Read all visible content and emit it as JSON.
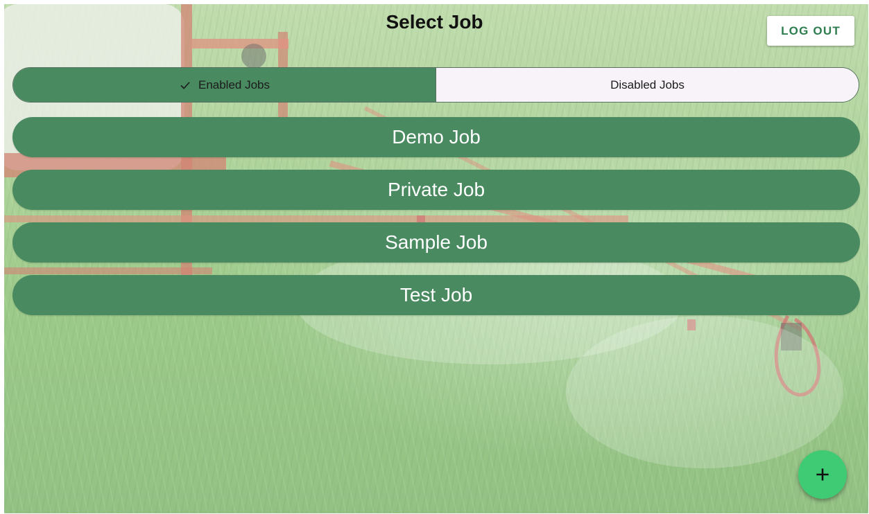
{
  "header": {
    "title": "Select Job",
    "logout_label": "LOG OUT"
  },
  "tabs": {
    "enabled_label": "Enabled Jobs",
    "disabled_label": "Disabled Jobs",
    "selected": "enabled"
  },
  "jobs": [
    {
      "label": "Demo Job"
    },
    {
      "label": "Private Job"
    },
    {
      "label": "Sample Job"
    },
    {
      "label": "Test Job"
    }
  ],
  "fab": {
    "icon": "plus-icon"
  },
  "colors": {
    "primary_green": "#4a8a61",
    "fab_green": "#3ecb74",
    "logout_text": "#2e7d4f"
  }
}
